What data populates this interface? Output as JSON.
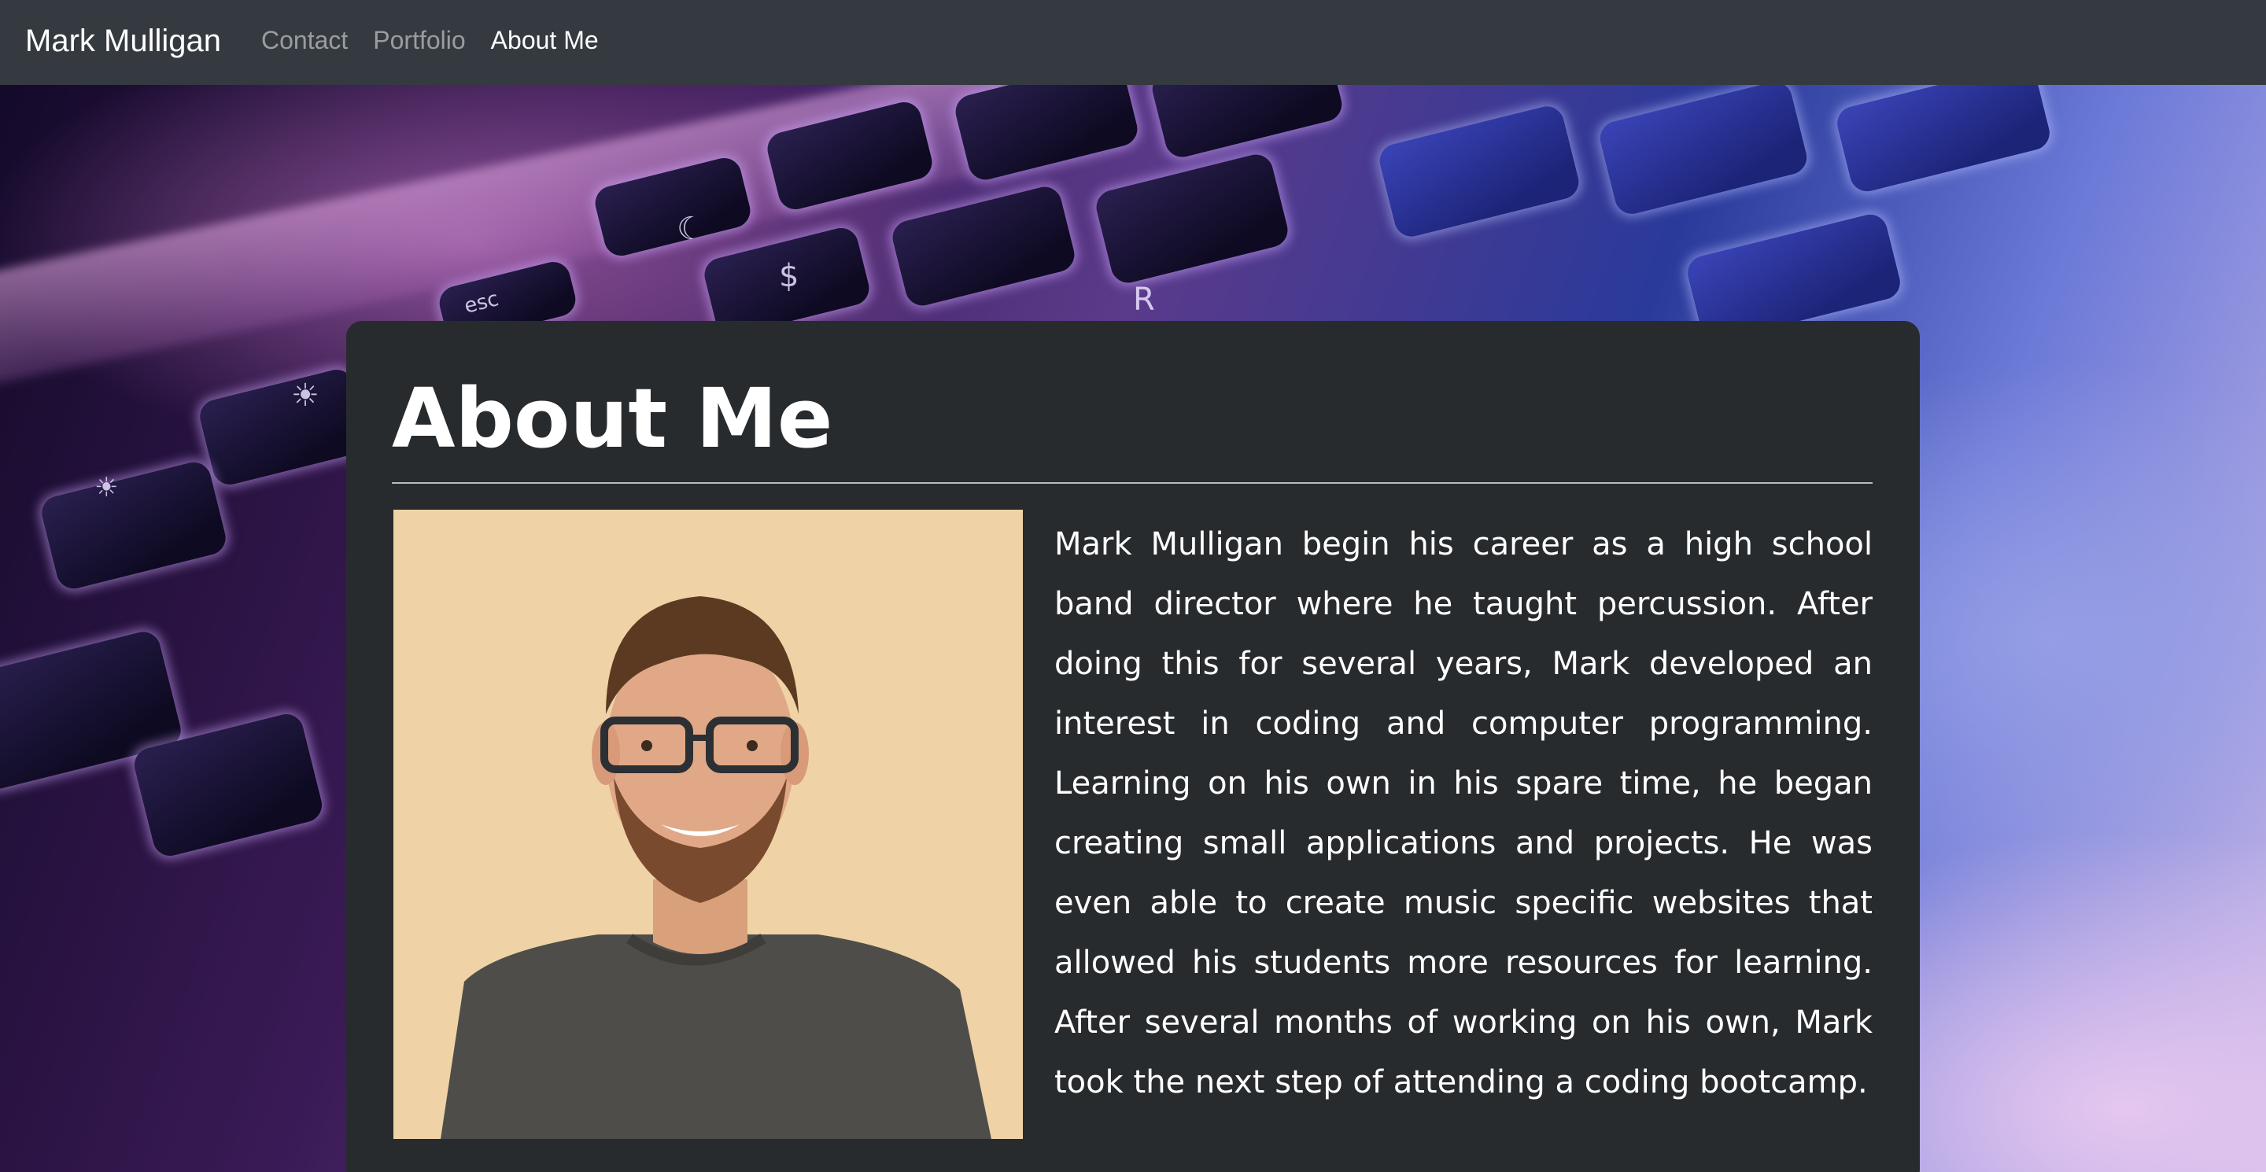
{
  "navbar": {
    "brand": "Mark Mulligan",
    "links": [
      {
        "label": "Contact",
        "active": false
      },
      {
        "label": "Portfolio",
        "active": false
      },
      {
        "label": "About Me",
        "active": true
      }
    ]
  },
  "hero": {
    "key_glyphs": [
      "esc",
      "☀",
      "☀",
      "☾",
      "$",
      "R"
    ]
  },
  "about": {
    "title": "About Me",
    "bio": "Mark Mulligan begin his career as a high school band director where he taught percussion. After doing this for several years, Mark developed an interest in coding and computer programming. Learning on his own in his spare time, he began creating small applications and projects. He was even able to create music specific websites that allowed his students more resources for learning. After several months of working on his own, Mark took the next step of attending a coding bootcamp."
  },
  "colors": {
    "navbar_bg": "#343a40",
    "card_bg": "#282b2d",
    "nav_active": "#ffffff",
    "nav_inactive": "rgba(255,255,255,0.5)"
  }
}
